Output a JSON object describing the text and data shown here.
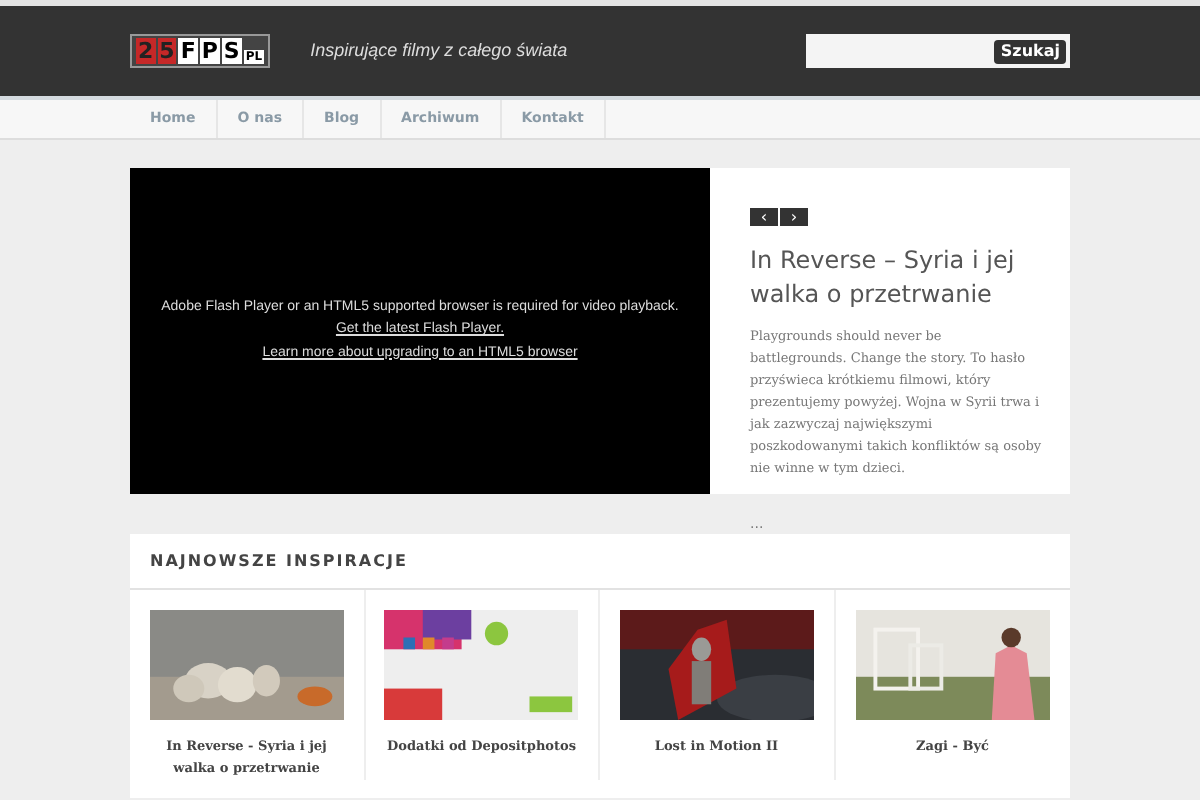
{
  "header": {
    "logo": {
      "number": "25",
      "letters": "FPS",
      "suffix": "PL"
    },
    "tagline": "Inspirujące filmy z całego świata",
    "search": {
      "button": "Szukaj"
    }
  },
  "nav": [
    {
      "label": "Home"
    },
    {
      "label": "O nas"
    },
    {
      "label": "Blog"
    },
    {
      "label": "Archiwum"
    },
    {
      "label": "Kontakt"
    }
  ],
  "video": {
    "message": "Adobe Flash Player or an HTML5 supported browser is required for video playback.",
    "links": [
      "Get the latest Flash Player.",
      "Learn more about upgrading to an HTML5 browser"
    ]
  },
  "feature": {
    "prev": "‹",
    "next": "›",
    "title": "In Reverse – Syria i jej walka o przetrwanie",
    "text": "Playgrounds should never be battlegrounds. Change the story. To hasło przyświeca krótkiemu filmowi, który prezentujemy powyżej. Wojna w Syrii trwa i jak zazwyczaj największymi poszkodowanymi takich konfliktów są osoby nie winne w tym dzieci.",
    "more": "..."
  },
  "latest": {
    "heading": "NAJNOWSZE INSPIRACJE",
    "items": [
      {
        "title": "In Reverse - Syria i jej walka o przetrwanie",
        "kind": "picture"
      },
      {
        "title": "Dodatki od Depositphotos",
        "kind": "picture"
      },
      {
        "title": "Lost in Motion II",
        "kind": "picture"
      },
      {
        "title": "Zagi - Być",
        "kind": "picture"
      }
    ]
  }
}
